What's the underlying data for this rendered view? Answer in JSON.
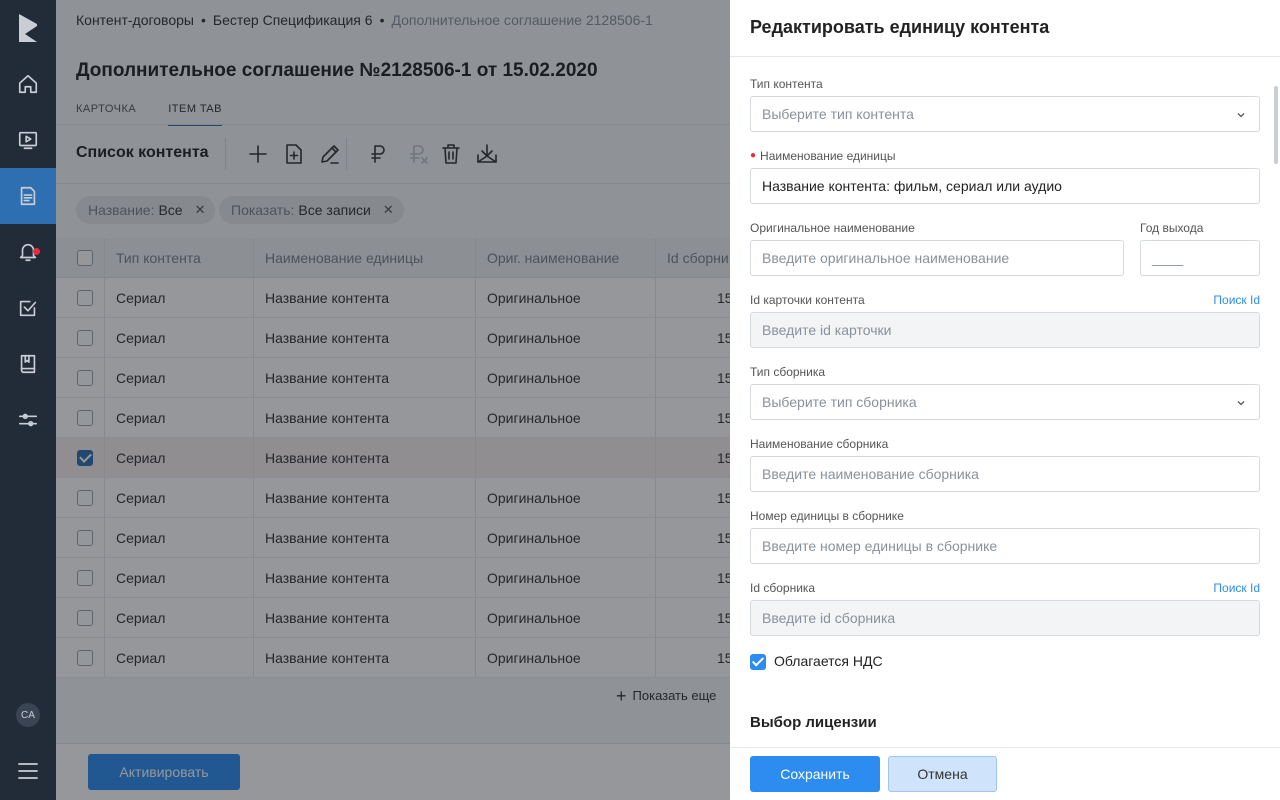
{
  "sidebar": {
    "avatar": "CA",
    "icons": [
      "home-icon",
      "video-icon",
      "document-icon",
      "bell-icon",
      "task-icon",
      "book-icon",
      "settings-sliders-icon",
      "menu-icon"
    ]
  },
  "breadcrumbs": {
    "item1": "Контент-договоры",
    "item2": "Бестер Спецификация 6",
    "item3": "Дополнительное соглашение 2128506-1",
    "separator": "•"
  },
  "page_title": "Дополнительное соглашение №2128506-1 от 15.02.2020",
  "tabs": [
    {
      "label": "КАРТОЧКА"
    },
    {
      "label": "ITEM TAB"
    }
  ],
  "list_title": "Список контента",
  "toolbar_icons": [
    "add-icon",
    "add-document-icon",
    "edit-icon",
    "ruble-icon",
    "ruble-remove-icon",
    "delete-icon",
    "download-icon"
  ],
  "filters": [
    {
      "key": "Название:",
      "value": "Все"
    },
    {
      "key": "Показать:",
      "value": "Все записи"
    }
  ],
  "table": {
    "headers": [
      "Тип контента",
      "Наименование единицы",
      "Ориг. наименование",
      "Id сборни"
    ],
    "rows": [
      {
        "type": "Сериал",
        "name": "Название контента",
        "orig": "Оригинальное",
        "id": "15"
      },
      {
        "type": "Сериал",
        "name": "Название контента",
        "orig": "Оригинальное",
        "id": "15"
      },
      {
        "type": "Сериал",
        "name": "Название контента",
        "orig": "Оригинальное",
        "id": "15"
      },
      {
        "type": "Сериал",
        "name": "Название контента",
        "orig": "Оригинальное",
        "id": "15"
      },
      {
        "type": "Сериал",
        "name": "Название контента",
        "orig": "",
        "id": "15"
      },
      {
        "type": "Сериал",
        "name": "Название контента",
        "orig": "Оригинальное",
        "id": "15"
      },
      {
        "type": "Сериал",
        "name": "Название контента",
        "orig": "Оригинальное",
        "id": "15"
      },
      {
        "type": "Сериал",
        "name": "Название контента",
        "orig": "Оригинальное",
        "id": "15"
      },
      {
        "type": "Сериал",
        "name": "Название контента",
        "orig": "Оригинальное",
        "id": "15"
      },
      {
        "type": "Сериал",
        "name": "Название контента",
        "orig": "Оригинальное",
        "id": "15"
      }
    ]
  },
  "show_more": "Показать еще",
  "activate_button": "Активировать",
  "drawer": {
    "title": "Редактировать единицу контента",
    "content_type": {
      "label": "Тип контента",
      "placeholder": "Выберите тип контента"
    },
    "unit_name": {
      "label": "Наименование единицы",
      "value": "Название контента: фильм, сериал или аудио"
    },
    "orig_name": {
      "label": "Оригинальное наименование",
      "placeholder": "Введите оригинальное наименование"
    },
    "year": {
      "label": "Год выхода",
      "placeholder": "____"
    },
    "card_id": {
      "label": "Id карточки контента",
      "link": "Поиск Id",
      "placeholder": "Введите id карточки"
    },
    "collection_type": {
      "label": "Тип сборника",
      "placeholder": "Выберите тип сборника"
    },
    "collection_name": {
      "label": "Наименование сборника",
      "placeholder": "Введите наименование сборника"
    },
    "unit_number": {
      "label": "Номер единицы в сборнике",
      "placeholder": "Введите номер единицы в сборнике"
    },
    "collection_id": {
      "label": "Id сборника",
      "link": "Поиск Id",
      "placeholder": "Введите id сборника"
    },
    "vat": {
      "label": "Облагается НДС",
      "checked": true
    },
    "license_section": "Выбор лицензии",
    "save": "Сохранить",
    "cancel": "Отмена"
  },
  "colors": {
    "primary": "#2d8cf0",
    "rail": "#222b38",
    "rail_active": "#2d6fb0",
    "required": "#e5303a"
  }
}
